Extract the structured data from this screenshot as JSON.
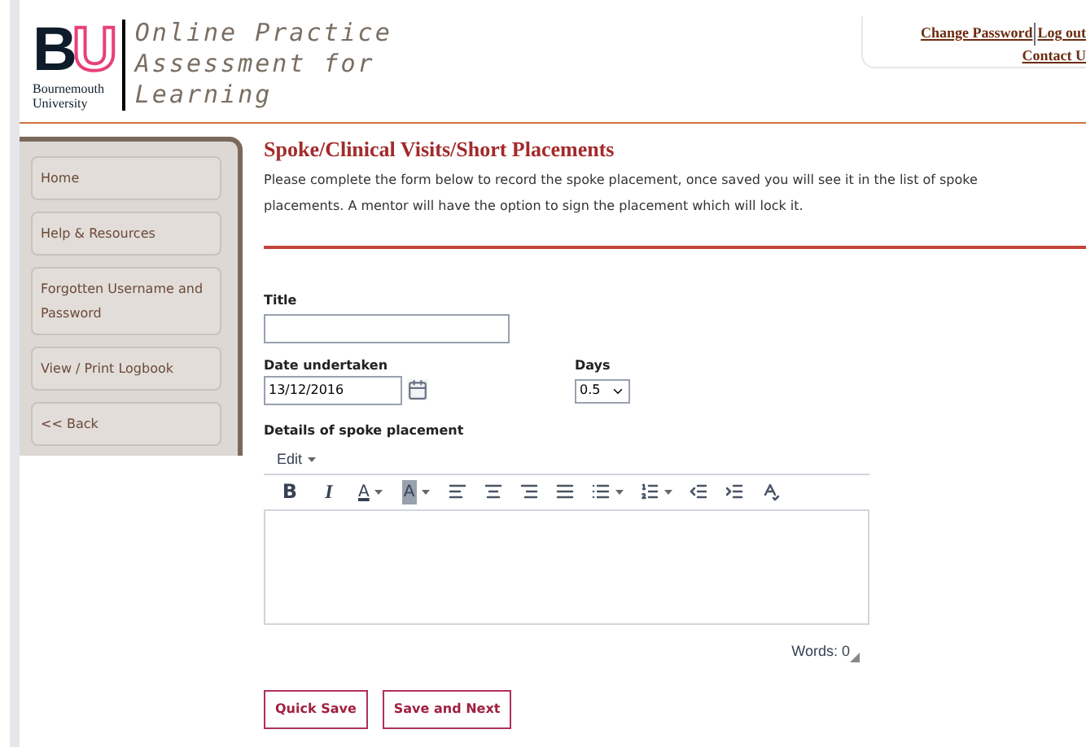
{
  "logo": {
    "letter_1": "B",
    "letter_2": "U",
    "line_1": "Bournemouth",
    "line_2": "University"
  },
  "site_title": [
    "Online Practice",
    "Assessment for",
    "Learning"
  ],
  "top_links": [
    {
      "label": "Change Password"
    },
    {
      "label": "Log out"
    },
    {
      "label": "Contact U"
    }
  ],
  "sidebar": {
    "items": [
      {
        "label": "Home"
      },
      {
        "label": "Help & Resources"
      },
      {
        "label": "Forgotten Username and Password"
      },
      {
        "label": "View / Print Logbook"
      },
      {
        "label": "<< Back"
      }
    ]
  },
  "heading": "Spoke/Clinical Visits/Short Placements",
  "intro": "Please complete the form below to record the spoke placement, once saved you will see it in the list of spoke placements.  A mentor will have the option to sign the placement which will lock it.",
  "form": {
    "title_label": "Title",
    "date_label": "Date undertaken",
    "date_value": "13/12/2016",
    "days_label": "Days",
    "days_value": "0.5",
    "details_label": "Details of spoke placement"
  },
  "editor": {
    "menu": "Edit",
    "toolbar": [
      {
        "kind": "bold",
        "text": "B"
      },
      {
        "kind": "italic",
        "text": "I"
      },
      {
        "kind": "color",
        "text": "A"
      },
      {
        "kind": "highlight",
        "text": "A"
      },
      {
        "kind": "align-left"
      },
      {
        "kind": "align-center"
      },
      {
        "kind": "align-right"
      },
      {
        "kind": "justify"
      },
      {
        "kind": "bullets"
      },
      {
        "kind": "numbers"
      },
      {
        "kind": "outdent"
      },
      {
        "kind": "indent"
      },
      {
        "kind": "spellcheck"
      }
    ],
    "word_count": "Words: 0"
  },
  "buttons": [
    {
      "label": "Quick Save"
    },
    {
      "label": "Save and Next"
    }
  ]
}
